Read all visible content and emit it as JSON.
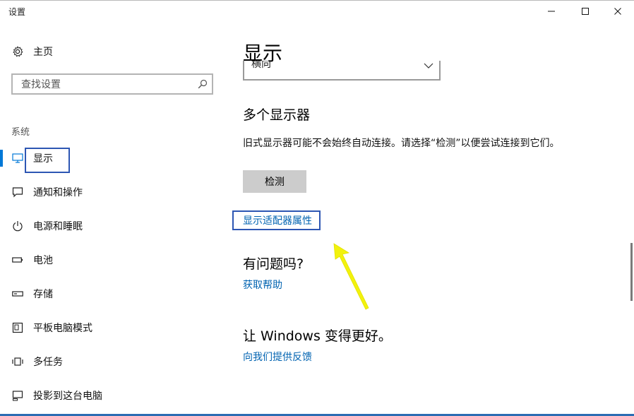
{
  "window": {
    "title": "设置",
    "minimize_glyph": "—",
    "maximize_glyph": "☐",
    "close_glyph": "✕"
  },
  "sidebar": {
    "home_label": "主页",
    "search_placeholder": "查找设置",
    "section_heading": "系统",
    "items": [
      {
        "label": "显示",
        "icon": "monitor-icon",
        "active": true
      },
      {
        "label": "通知和操作",
        "icon": "notification-icon"
      },
      {
        "label": "电源和睡眠",
        "icon": "power-icon"
      },
      {
        "label": "电池",
        "icon": "battery-icon"
      },
      {
        "label": "存储",
        "icon": "storage-icon"
      },
      {
        "label": "平板电脑模式",
        "icon": "tablet-mode-icon"
      },
      {
        "label": "多任务",
        "icon": "multitasking-icon"
      },
      {
        "label": "投影到这台电脑",
        "icon": "project-icon"
      }
    ]
  },
  "main": {
    "title": "显示",
    "orientation_value": "横向",
    "multiple_displays_heading": "多个显示器",
    "multiple_displays_desc": "旧式显示器可能不会始终自动连接。请选择“检测”以便尝试连接到它们。",
    "detect_button": "检测",
    "adapter_link": "显示适配器属性",
    "question_heading": "有问题吗?",
    "help_link": "获取帮助",
    "better_heading": "让 Windows 变得更好。",
    "feedback_link": "向我们提供反馈"
  },
  "colors": {
    "accent": "#0078d7",
    "link": "#0063b1",
    "highlight_box": "#2d56b3",
    "annotation_arrow": "#f2f20d"
  }
}
